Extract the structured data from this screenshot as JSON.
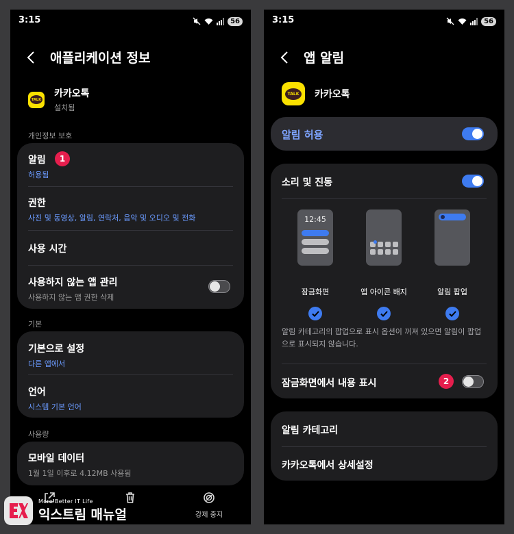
{
  "left": {
    "status": {
      "time": "3:15",
      "battery": "56"
    },
    "header": {
      "title": "애플리케이션 정보"
    },
    "app": {
      "name": "카카오톡",
      "status": "설치됨",
      "icon_text": "TALK"
    },
    "sections": {
      "privacy": "개인정보 보호",
      "basic": "기본",
      "usage": "사용량"
    },
    "rows": {
      "notification": {
        "title": "알림",
        "sub": "허용됨",
        "badge": "1"
      },
      "permission": {
        "title": "권한",
        "sub": "사진 및 동영상, 알림, 연락처, 음악 및 오디오 및 전화"
      },
      "screen_time": {
        "title": "사용 시간"
      },
      "unused": {
        "title": "사용하지 않는 앱 관리",
        "sub": "사용하지 않는 앱 권한 삭제",
        "toggle": "off"
      },
      "default": {
        "title": "기본으로 설정",
        "sub": "다른 앱에서"
      },
      "language": {
        "title": "언어",
        "sub": "시스템 기본 언어"
      },
      "mobile_data": {
        "title": "모바일 데이터",
        "sub": "1월 1일 이후로 4.12MB 사용됨"
      }
    },
    "bottom": {
      "force_stop": "강제 중지"
    }
  },
  "right": {
    "status": {
      "time": "3:15",
      "battery": "56"
    },
    "header": {
      "title": "앱 알림"
    },
    "app": {
      "name": "카카오톡",
      "icon_text": "TALK"
    },
    "allow": {
      "label": "알림 허용",
      "toggle": "on"
    },
    "sound": {
      "label": "소리 및 진동",
      "toggle": "on"
    },
    "previews": {
      "lock_time": "12:45",
      "lock": "잠금화면",
      "badge": "앱 아이콘 배지",
      "popup": "알림 팝업"
    },
    "info": "알림 카테고리의 팝업으로 표시 옵션이 꺼져 있으면 알림이 팝업으로 표시되지 않습니다.",
    "lock_content": {
      "label": "잠금화면에서 내용 표시",
      "badge": "2",
      "toggle": "off"
    },
    "category": "알림 카테고리",
    "detail": "카카오톡에서 상세설정"
  },
  "watermark": {
    "small": "More Better IT Life",
    "big": "익스트림 매뉴얼"
  },
  "colors": {
    "accent": "#3e7bf0",
    "link": "#6b9bff",
    "badge": "#e61e4d",
    "card": "#1e1e20",
    "kakao": "#fae100"
  }
}
